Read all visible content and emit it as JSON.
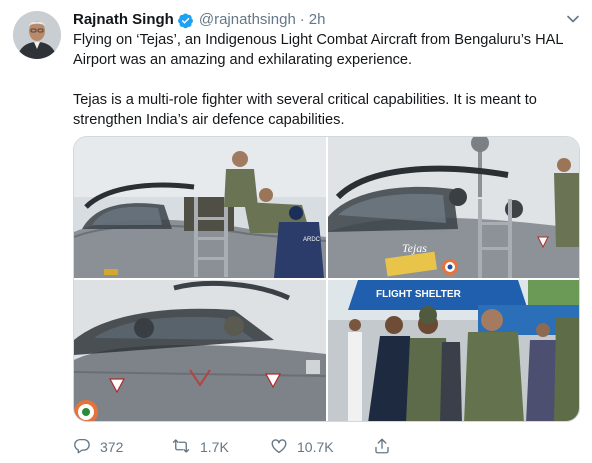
{
  "tweet": {
    "author_name": "Rajnath Singh",
    "handle": "@rajnathsingh",
    "separator": "·",
    "time": "2h",
    "paragraph1": "Flying on ‘Tejas’, an Indigenous Light Combat Aircraft from Bengaluru’s HAL Airport was an amazing and exhilarating experience.",
    "paragraph2": "Tejas is a multi-role fighter with several critical capabilities. It is meant to strengthen India’s air defence capabilities."
  },
  "photos": {
    "photo2_aircraft_name": "Tejas",
    "photo1_shirt_text": "ARDC",
    "photo4_building_sign": "FLIGHT SHELTER"
  },
  "stats": {
    "replies": "372",
    "retweets": "1.7K",
    "likes": "10.7K"
  },
  "icons": {
    "verified": "verified-badge-icon",
    "menu": "chevron-down-icon",
    "reply": "reply-icon",
    "retweet": "retweet-icon",
    "like": "heart-icon",
    "share": "share-icon"
  },
  "colors": {
    "brand": "#1da1f2",
    "text": "#14171a",
    "muted": "#657786"
  }
}
